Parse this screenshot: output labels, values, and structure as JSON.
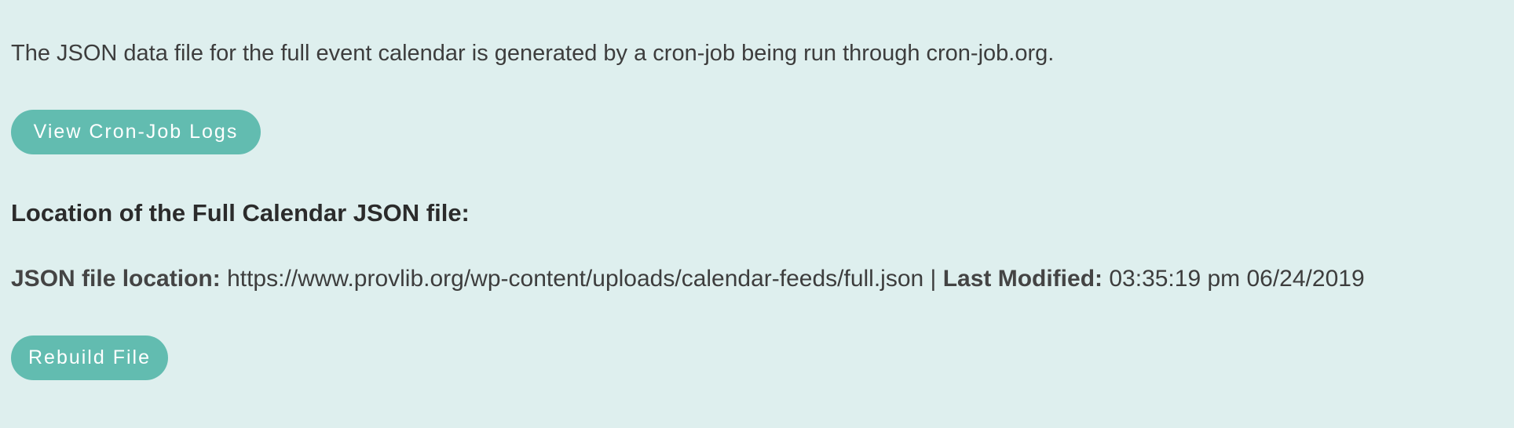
{
  "intro_text": "The JSON data file for the full event calendar is generated by a cron-job being run through cron-job.org.",
  "view_logs_button": "View Cron-Job Logs",
  "section_heading": "Location of the Full Calendar JSON file:",
  "file_info": {
    "location_label": "JSON file location:",
    "location_value": "https://www.provlib.org/wp-content/uploads/calendar-feeds/full.json",
    "separator": "|",
    "modified_label": "Last Modified:",
    "modified_value": "03:35:19 pm 06/24/2019"
  },
  "rebuild_button": "Rebuild File",
  "colors": {
    "background": "#deefee",
    "button": "#62bcb0",
    "button_text": "#ffffff",
    "text": "#3d3d3d"
  }
}
